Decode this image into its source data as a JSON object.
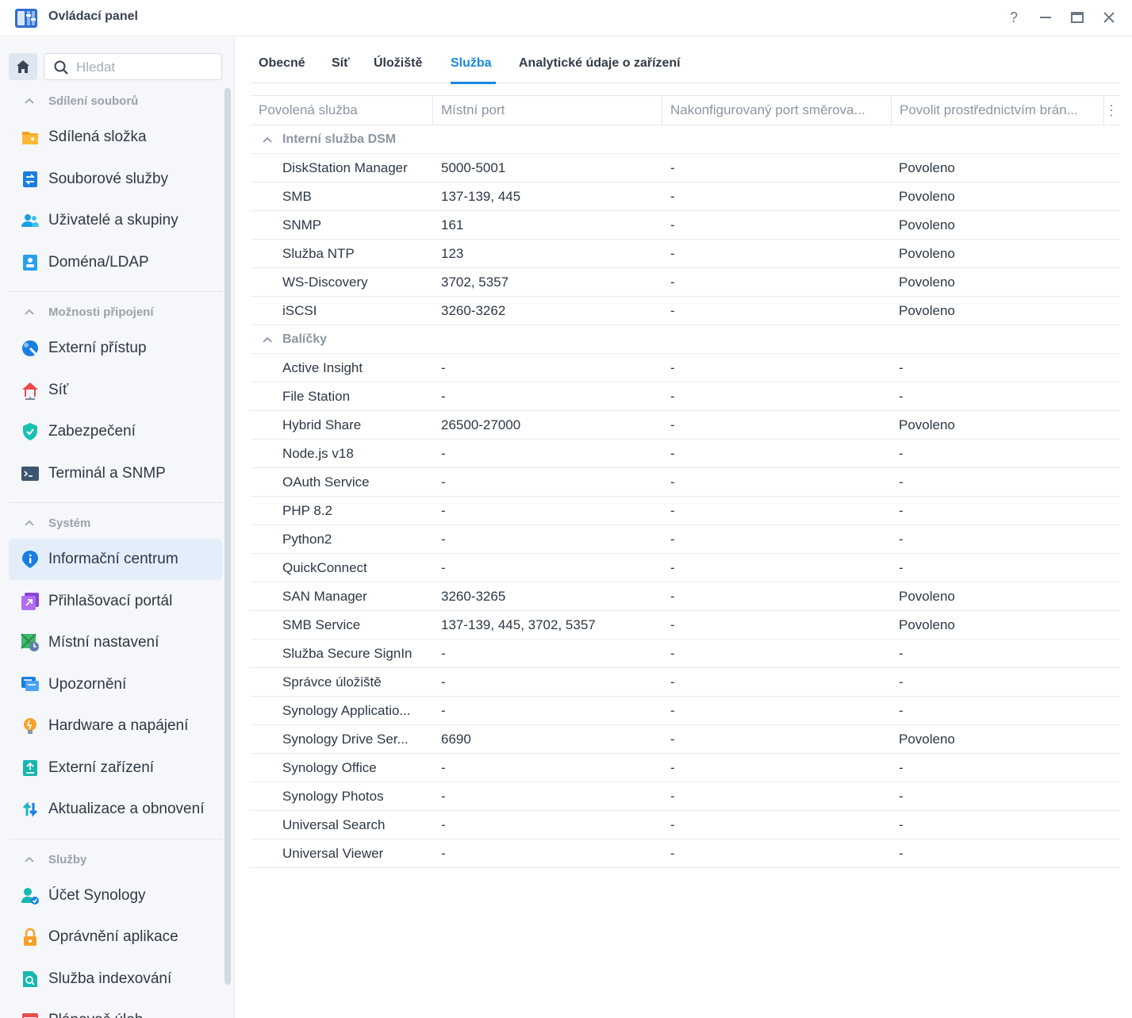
{
  "window": {
    "title": "Ovládací panel",
    "help_icon": "question-icon",
    "minimize_icon": "minimize-icon",
    "maximize_icon": "maximize-icon",
    "close_icon": "close-icon"
  },
  "search": {
    "placeholder": "Hledat"
  },
  "sidebar": {
    "sections": [
      {
        "title": "Sdílení souborů",
        "items": [
          {
            "label": "Sdílená složka",
            "icon": "shared-folder-icon"
          },
          {
            "label": "Souborové služby",
            "icon": "file-services-icon"
          },
          {
            "label": "Uživatelé a skupiny",
            "icon": "users-groups-icon"
          },
          {
            "label": "Doména/LDAP",
            "icon": "domain-ldap-icon"
          }
        ]
      },
      {
        "title": "Možnosti připojení",
        "items": [
          {
            "label": "Externí přístup",
            "icon": "external-access-icon"
          },
          {
            "label": "Síť",
            "icon": "network-icon"
          },
          {
            "label": "Zabezpečení",
            "icon": "security-shield-icon"
          },
          {
            "label": "Terminál a SNMP",
            "icon": "terminal-icon"
          }
        ]
      },
      {
        "title": "Systém",
        "items": [
          {
            "label": "Informační centrum",
            "icon": "info-center-icon"
          },
          {
            "label": "Přihlašovací portál",
            "icon": "login-portal-icon"
          },
          {
            "label": "Místní nastavení",
            "icon": "regional-options-icon"
          },
          {
            "label": "Upozornění",
            "icon": "notification-icon"
          },
          {
            "label": "Hardware a napájení",
            "icon": "hardware-power-icon"
          },
          {
            "label": "Externí zařízení",
            "icon": "external-devices-icon"
          },
          {
            "label": "Aktualizace a obnovení",
            "icon": "update-restore-icon"
          }
        ]
      },
      {
        "title": "Služby",
        "items": [
          {
            "label": "Účet Synology",
            "icon": "synology-account-icon"
          },
          {
            "label": "Oprávnění aplikace",
            "icon": "app-privileges-icon"
          },
          {
            "label": "Služba indexování",
            "icon": "indexing-service-icon"
          },
          {
            "label": "Plánovač úloh",
            "icon": "task-scheduler-icon"
          }
        ]
      }
    ],
    "active_item": "Informační centrum"
  },
  "tabs": [
    {
      "label": "Obecné"
    },
    {
      "label": "Síť"
    },
    {
      "label": "Úložiště"
    },
    {
      "label": "Služba"
    },
    {
      "label": "Analytické údaje o zařízení"
    }
  ],
  "active_tab": "Služba",
  "table": {
    "columns": [
      "Povolená služba",
      "Místní port",
      "Nakonfigurovaný port směrova...",
      "Povolit prostřednictvím brán..."
    ],
    "groups": [
      {
        "title": "Interní služba DSM",
        "rows": [
          [
            "DiskStation Manager",
            "5000-5001",
            "-",
            "Povoleno"
          ],
          [
            "SMB",
            "137-139, 445",
            "-",
            "Povoleno"
          ],
          [
            "SNMP",
            "161",
            "-",
            "Povoleno"
          ],
          [
            "Služba NTP",
            "123",
            "-",
            "Povoleno"
          ],
          [
            "WS-Discovery",
            "3702, 5357",
            "-",
            "Povoleno"
          ],
          [
            "iSCSI",
            "3260-3262",
            "-",
            "Povoleno"
          ]
        ]
      },
      {
        "title": "Balíčky",
        "rows": [
          [
            "Active Insight",
            "-",
            "-",
            "-"
          ],
          [
            "File Station",
            "-",
            "-",
            "-"
          ],
          [
            "Hybrid Share",
            "26500-27000",
            "-",
            "Povoleno"
          ],
          [
            "Node.js v18",
            "-",
            "-",
            "-"
          ],
          [
            "OAuth Service",
            "-",
            "-",
            "-"
          ],
          [
            "PHP 8.2",
            "-",
            "-",
            "-"
          ],
          [
            "Python2",
            "-",
            "-",
            "-"
          ],
          [
            "QuickConnect",
            "-",
            "-",
            "-"
          ],
          [
            "SAN Manager",
            "3260-3265",
            "-",
            "Povoleno"
          ],
          [
            "SMB Service",
            "137-139, 445, 3702, 5357",
            "-",
            "Povoleno"
          ],
          [
            "Služba Secure SignIn",
            "-",
            "-",
            "-"
          ],
          [
            "Správce úložiště",
            "-",
            "-",
            "-"
          ],
          [
            "Synology Applicatio...",
            "-",
            "-",
            "-"
          ],
          [
            "Synology Drive Ser...",
            "6690",
            "-",
            "Povoleno"
          ],
          [
            "Synology Office",
            "-",
            "-",
            "-"
          ],
          [
            "Synology Photos",
            "-",
            "-",
            "-"
          ],
          [
            "Universal Search",
            "-",
            "-",
            "-"
          ],
          [
            "Universal Viewer",
            "-",
            "-",
            "-"
          ]
        ]
      }
    ]
  },
  "colors": {
    "accent": "#1a88e0",
    "active_bg": "#e4eefa"
  }
}
